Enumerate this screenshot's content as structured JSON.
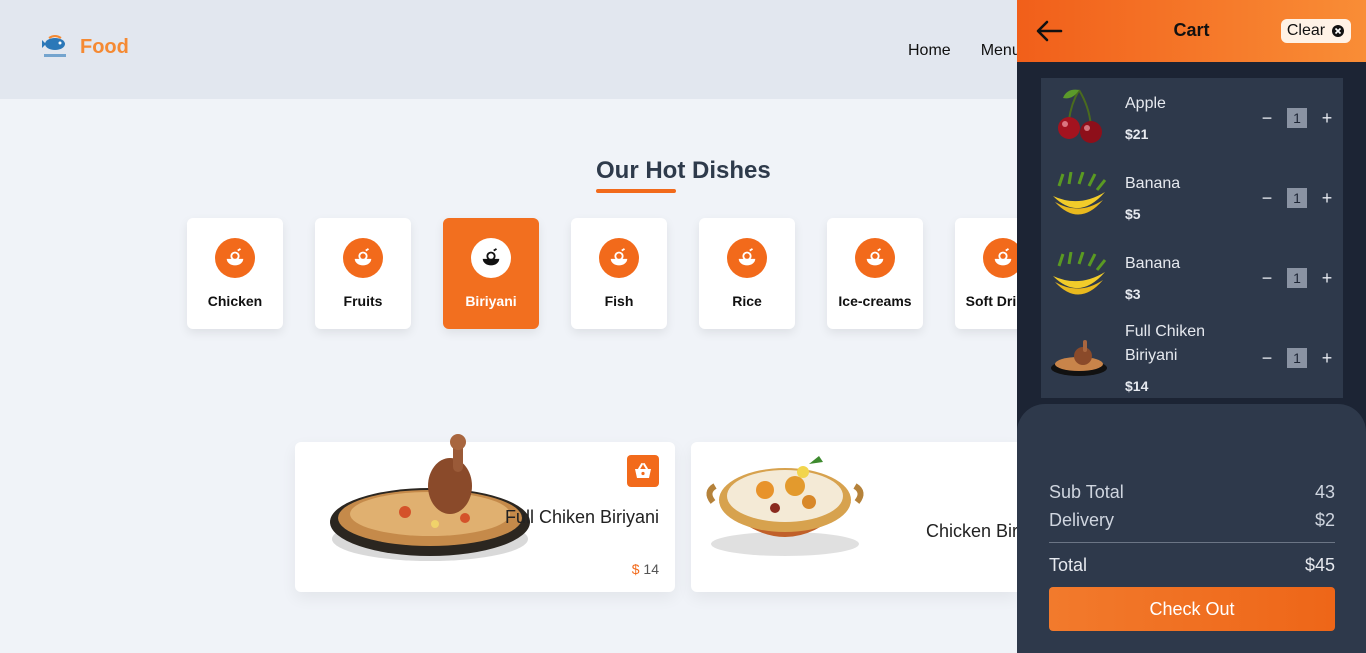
{
  "header": {
    "logo_text": "Food",
    "nav": [
      "Home",
      "Menu"
    ]
  },
  "hot_dishes": {
    "title": "Our Hot Dishes",
    "categories": [
      {
        "label": "Chicken",
        "active": false
      },
      {
        "label": "Fruits",
        "active": false
      },
      {
        "label": "Biriyani",
        "active": true
      },
      {
        "label": "Fish",
        "active": false
      },
      {
        "label": "Rice",
        "active": false
      },
      {
        "label": "Ice-creams",
        "active": false
      },
      {
        "label": "Soft Drinks",
        "active": false
      }
    ]
  },
  "dishes": [
    {
      "name": "Full Chiken Biriyani",
      "currency": "$",
      "price": "14"
    },
    {
      "name": "Chicken Biriyani",
      "currency": "$",
      "price": ""
    }
  ],
  "cart": {
    "title": "Cart",
    "clear_label": "Clear",
    "items": [
      {
        "name": "Apple",
        "price": "$21",
        "qty": "1",
        "icon": "cherry"
      },
      {
        "name": "Banana",
        "price": "$5",
        "qty": "1",
        "icon": "banana"
      },
      {
        "name": "Banana",
        "price": "$3",
        "qty": "1",
        "icon": "banana"
      },
      {
        "name": "Full Chiken Biriyani",
        "price": "$14",
        "qty": "1",
        "icon": "biriyani-plate"
      }
    ],
    "sub_total_label": "Sub Total",
    "sub_total_value": "43",
    "delivery_label": "Delivery",
    "delivery_value": "$2",
    "total_label": "Total",
    "total_value": "$45",
    "checkout_label": "Check Out",
    "minus": "−",
    "plus": "+"
  },
  "colors": {
    "accent": "#f26a1b",
    "cart_bg": "#1c2434",
    "cart_card": "#2e394b"
  }
}
